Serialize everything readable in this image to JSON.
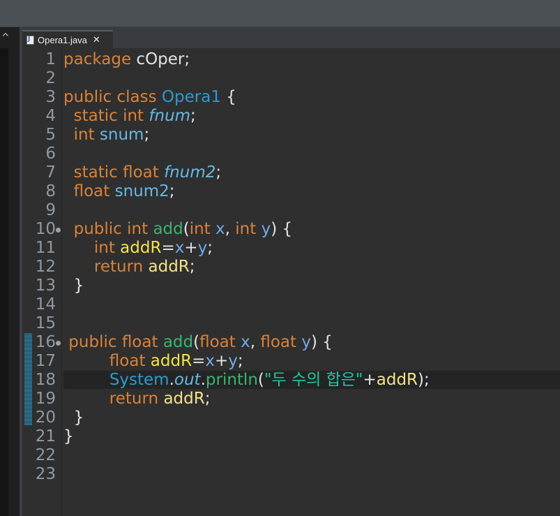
{
  "tab": {
    "file_icon": "java-file-icon",
    "label": "Opera1.java",
    "close": "✕"
  },
  "gutter": {
    "line_numbers": [
      "1",
      "2",
      "3",
      "4",
      "5",
      "6",
      "7",
      "8",
      "9",
      "10",
      "11",
      "12",
      "13",
      "14",
      "15",
      "16",
      "17",
      "18",
      "19",
      "20",
      "21",
      "22",
      "23"
    ]
  },
  "code": {
    "l1": {
      "kw_package": "package",
      "pkg": " cOper;"
    },
    "l3": {
      "kw1": "public class ",
      "cls": "Opera1",
      "rest": " {"
    },
    "l4": {
      "kw": "  static int ",
      "fld": "fnum",
      "rest": ";"
    },
    "l5": {
      "kw": "  int ",
      "fld": "snum",
      "rest": ";"
    },
    "l7": {
      "kw": "  static float ",
      "fld": "fnum2",
      "rest": ";"
    },
    "l8": {
      "kw": "  float ",
      "fld": "snum2",
      "rest": ";"
    },
    "l10": {
      "kw": "  public int ",
      "meth": "add",
      "p1": "(",
      "t1": "int",
      "sp1": " ",
      "x": "x",
      "comma": ", ",
      "t2": "int",
      "sp2": " ",
      "y": "y",
      "end": ") {"
    },
    "l11": {
      "kw": "      int ",
      "var": "addR",
      "eq": "=",
      "x": "x",
      "plus": "+",
      "y": "y",
      "semi": ";"
    },
    "l12": {
      "kw": "      return ",
      "var": "addR",
      "semi": ";"
    },
    "l13": {
      "brace": "  }"
    },
    "l16": {
      "kw": " public float ",
      "meth": "add",
      "p1": "(",
      "t1": "float",
      "sp1": " ",
      "x": "x",
      "comma": ", ",
      "t2": "float",
      "sp2": " ",
      "y": "y",
      "end": ") {"
    },
    "l17": {
      "kw": "         float ",
      "var": "addR",
      "eq": "=",
      "x": "x",
      "plus": "+",
      "y": "y",
      "semi": ";"
    },
    "l18": {
      "indent": "         ",
      "sys": "System",
      "dot1": ".",
      "out": "out",
      "dot2": ".",
      "meth": "println",
      "open": "(",
      "str": "\"두 수의 합은\"",
      "plus": "+",
      "var": "addR",
      "close": ");"
    },
    "l19": {
      "kw": "         return ",
      "var": "addR",
      "semi": ";"
    },
    "l20": {
      "brace": "  }"
    },
    "l21": {
      "brace": "}"
    }
  },
  "colors": {
    "background": "#2f2f2f",
    "keyword": "#d9823b",
    "class": "#2b9bcf",
    "field": "#66b8e5",
    "method": "#3cb371",
    "parameter": "#74a8e8",
    "local_variable": "#f2e34a",
    "string": "#1ec6a1",
    "line_number": "#8e9aa4"
  }
}
